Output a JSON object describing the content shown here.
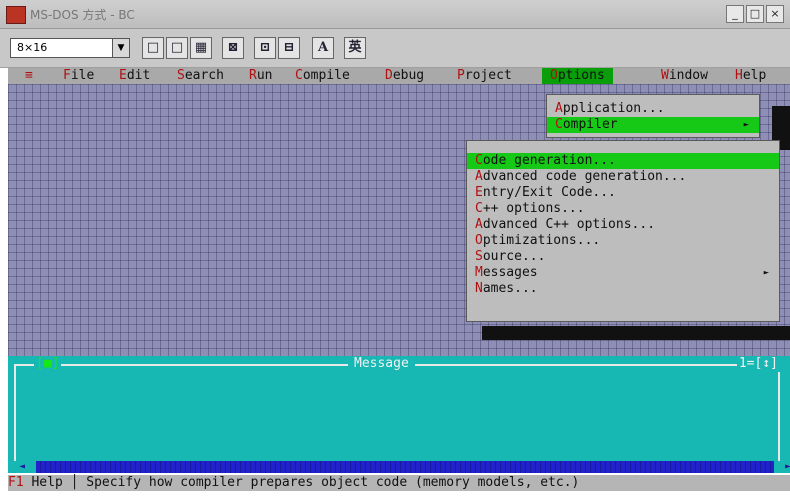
{
  "window": {
    "title": "MS-DOS 方式 - BC",
    "buttons": [
      "_",
      "□",
      "×"
    ]
  },
  "toolbar": {
    "font_select_value": "8×16",
    "buttons": [
      "□",
      "□",
      "▦",
      "⊠",
      "⊡",
      "⊟",
      "A",
      "英"
    ]
  },
  "menubar": {
    "items": [
      {
        "hotkey": "≡",
        "rest": ""
      },
      {
        "hotkey": "F",
        "rest": "ile"
      },
      {
        "hotkey": "E",
        "rest": "dit"
      },
      {
        "hotkey": "S",
        "rest": "earch"
      },
      {
        "hotkey": "R",
        "rest": "un"
      },
      {
        "hotkey": "C",
        "rest": "ompile"
      },
      {
        "hotkey": "D",
        "rest": "ebug"
      },
      {
        "hotkey": "P",
        "rest": "roject"
      },
      {
        "hotkey": "O",
        "rest": "ptions"
      },
      {
        "hotkey": "W",
        "rest": "indow"
      },
      {
        "hotkey": "H",
        "rest": "elp"
      }
    ],
    "active": "Options"
  },
  "options_menu": {
    "items": [
      {
        "hotkey": "A",
        "rest": "pplication..."
      },
      {
        "hotkey": "C",
        "rest": "ompiler"
      }
    ],
    "selected_index": 1
  },
  "compiler_submenu": {
    "items": [
      {
        "hotkey": "C",
        "rest": "ode generation..."
      },
      {
        "hotkey": "A",
        "rest": "dvanced code generation..."
      },
      {
        "hotkey": "E",
        "rest": "ntry/Exit Code..."
      },
      {
        "hotkey": "C",
        "rest": "++ options..."
      },
      {
        "hotkey": "A",
        "rest": "dvanced C++ options..."
      },
      {
        "hotkey": "O",
        "rest": "ptimizations..."
      },
      {
        "hotkey": "S",
        "rest": "ource..."
      },
      {
        "hotkey": "M",
        "rest": "essages"
      },
      {
        "hotkey": "N",
        "rest": "ames..."
      }
    ],
    "selected_index": 0,
    "has_submenu_index": 7
  },
  "message_window": {
    "title": "Message",
    "close_marker": "[■]",
    "controls": "1=[↕]"
  },
  "statusbar": {
    "f1": "F1",
    "text": " Help │ Specify how compiler prepares object code (memory models, etc.)"
  },
  "colors": {
    "desktop": "#8f8fb6",
    "menu": "#bdbdbd",
    "selection": "#17c917",
    "message_bg": "#17b8b4",
    "hotkey": "#b01010"
  }
}
